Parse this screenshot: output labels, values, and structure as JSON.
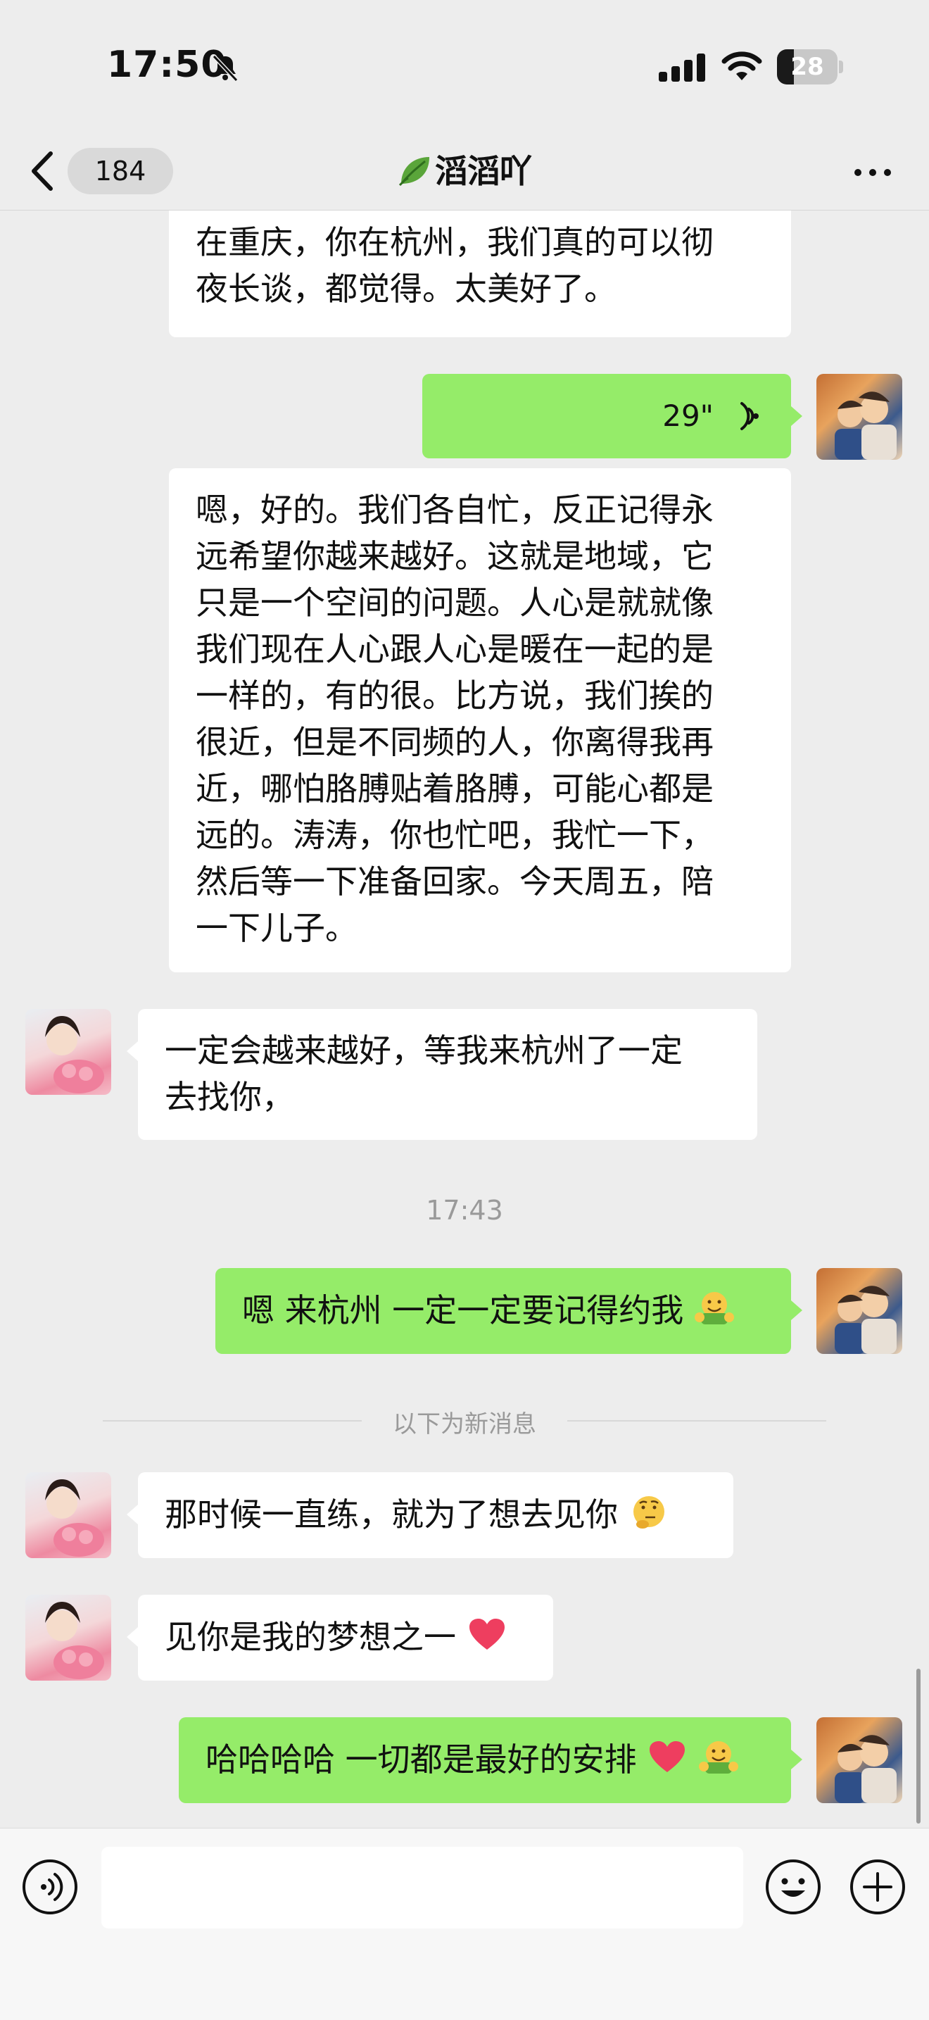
{
  "status_bar": {
    "time": "17:50",
    "battery": "28",
    "battery_level": 0.28
  },
  "nav": {
    "unread_count": "184",
    "title": "滔滔吖"
  },
  "messages": [
    {
      "sender": "me",
      "text": "我觉得你如果在我们在同城，或者我\n在重庆，你在杭州，我们真的可以彻\n夜长谈，都觉得。太美好了。"
    },
    {
      "sender": "me",
      "type": "voice",
      "duration": "29\""
    },
    {
      "sender": "me",
      "text": "嗯，好的。我们各自忙，反正记得永\n远希望你越来越好。这就是地域，它\n只是一个空间的问题。人心是就就像\n我们现在人心跟人心是暖在一起的是\n一样的，有的很。比方说，我们挨的\n很近，但是不同频的人，你离得我再\n近，哪怕胳膊贴着胳膊，可能心都是\n远的。涛涛，你也忙吧，我忙一下，\n然后等一下准备回家。今天周五，陪\n一下儿子。"
    },
    {
      "sender": "her",
      "text": "一定会越来越好，等我来杭州了一定\n去找你，"
    },
    {
      "sender": "me",
      "text": "嗯 来杭州 一定一定要记得约我"
    },
    {
      "sender": "her",
      "text": "那时候一直练，就为了想去见你"
    },
    {
      "sender": "her",
      "text": "见你是我的梦想之一"
    },
    {
      "sender": "me",
      "text": "哈哈哈哈 一切都是最好的安排"
    }
  ],
  "timestamps": {
    "t1": "17:43"
  },
  "new_messages_label": "以下为新消息",
  "input": {
    "value": "",
    "placeholder": ""
  },
  "colors": {
    "background": "#ededed",
    "my_bubble": "#95ec69",
    "their_bubble": "#ffffff",
    "timestamp_text": "#9a9a9a"
  },
  "icons": {
    "emoji_grin": "hugging-face-emoji",
    "emoji_think": "thinking-face-emoji",
    "emoji_heart": "red-heart-emoji"
  }
}
